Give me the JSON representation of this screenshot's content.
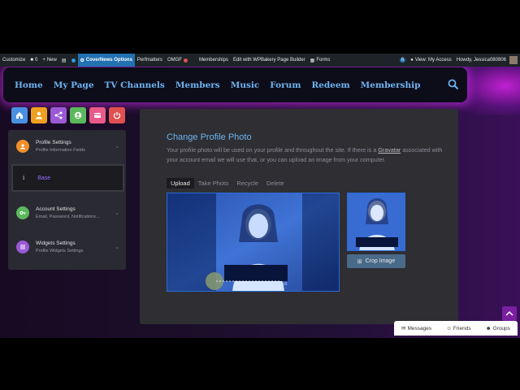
{
  "adminbar": {
    "customize": "Customize",
    "comments_count": "0",
    "new": "New",
    "covernews": "CoverNews Options",
    "perfmatters": "Perfmatters",
    "omgf": "OMGF",
    "memberships": "Memberships",
    "wpbakery": "Edit with WPBakery Page Builder",
    "forms": "Forms",
    "badge_count": "6",
    "view": "View: My Access",
    "howdy": "Howdy, Jessica080806"
  },
  "nav": {
    "items": [
      "Home",
      "My Page",
      "TV Channels",
      "Members",
      "Music",
      "Forum",
      "Redeem",
      "Membership"
    ]
  },
  "sidebar": {
    "icon_buttons": [
      {
        "name": "home-icon",
        "color": "#4a90e2"
      },
      {
        "name": "user-icon",
        "color": "#f0a020"
      },
      {
        "name": "share-icon",
        "color": "#9b59d6"
      },
      {
        "name": "profile-icon",
        "color": "#5cb85c"
      },
      {
        "name": "card-icon",
        "color": "#e85a8a"
      },
      {
        "name": "power-icon",
        "color": "#e05050"
      }
    ],
    "profile_settings": {
      "title": "Profile Settings",
      "subtitle": "Profile Information Fields"
    },
    "base": {
      "icon": "i",
      "label": "Base"
    },
    "account_settings": {
      "title": "Account Settings",
      "subtitle": "Email, Password, Notifications..."
    },
    "widgets_settings": {
      "title": "Widgets Settings",
      "subtitle": "Profile Widgets Settings"
    }
  },
  "main": {
    "title": "Change Profile Photo",
    "desc_before": "Your profile photo will be used on your profile and throughout the site. If there is a ",
    "gravatar": "Gravatar",
    "desc_after": " associated with your account email we will use that, or you can upload an image from your computer.",
    "tabs": [
      "Upload",
      "Take Photo",
      "Recycle",
      "Delete"
    ],
    "crop_button": "Crop Image"
  },
  "chatbar": {
    "messages": "Messages",
    "friends": "Friends",
    "groups": "Groups"
  }
}
